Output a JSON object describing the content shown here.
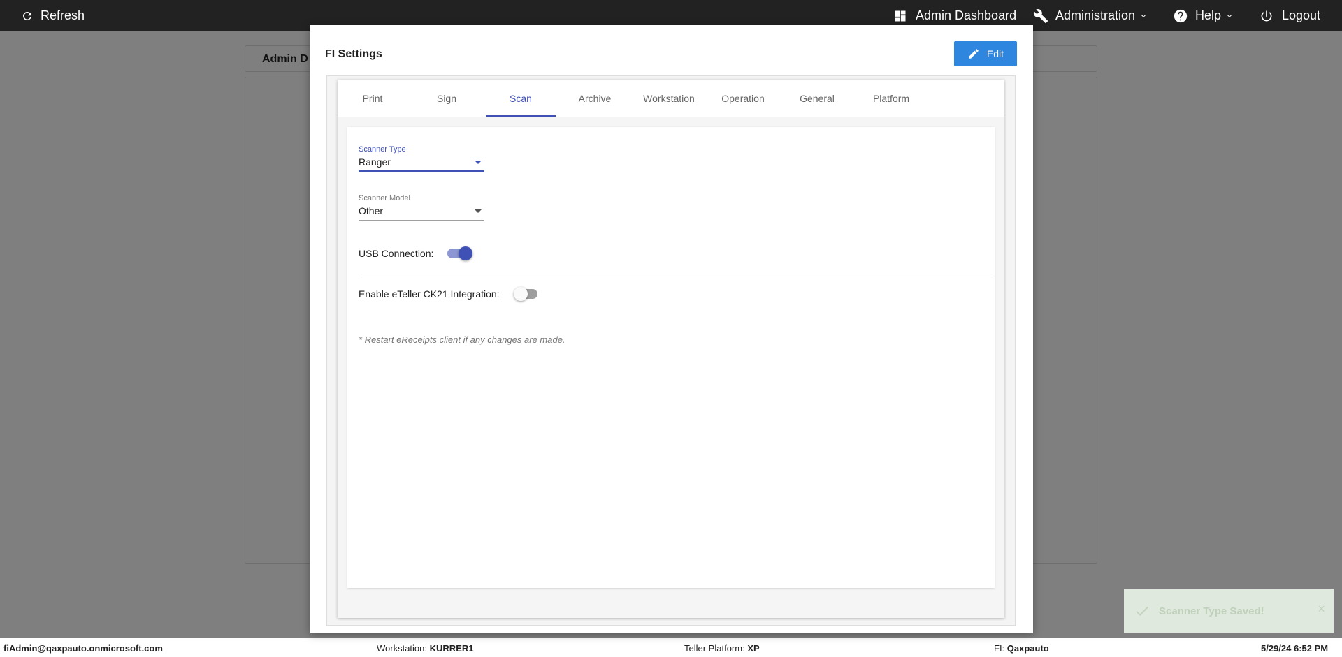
{
  "topbar": {
    "refresh": "Refresh",
    "admin_dashboard": "Admin Dashboard",
    "administration": "Administration",
    "help": "Help",
    "logout": "Logout"
  },
  "background": {
    "card_title": "Admin D"
  },
  "modal": {
    "title": "FI Settings",
    "edit_label": "Edit",
    "tabs": [
      {
        "label": "Print"
      },
      {
        "label": "Sign"
      },
      {
        "label": "Scan"
      },
      {
        "label": "Archive"
      },
      {
        "label": "Workstation"
      },
      {
        "label": "Operation"
      },
      {
        "label": "General"
      },
      {
        "label": "Platform"
      }
    ],
    "active_tab": "Scan",
    "scan": {
      "scanner_type_label": "Scanner Type",
      "scanner_type_value": "Ranger",
      "scanner_model_label": "Scanner Model",
      "scanner_model_value": "Other",
      "usb_connection_label": "USB Connection:",
      "usb_connection_on": true,
      "eteller_label": "Enable eTeller CK21 Integration:",
      "eteller_on": false,
      "note": "* Restart eReceipts client if any changes are made."
    }
  },
  "toast": {
    "message": "Scanner Type Saved!",
    "close": "×"
  },
  "footer": {
    "user": "fiAdmin@qaxpauto.onmicrosoft.com",
    "workstation_label": "Workstation:",
    "workstation_value": "KURRER1",
    "teller_platform_label": "Teller Platform:",
    "teller_platform_value": "XP",
    "fi_label": "FI:",
    "fi_value": "Qaxpauto",
    "datetime": "5/29/24 6:52 PM"
  },
  "colors": {
    "accent": "#3f51b5",
    "edit_button": "#2e86de",
    "topbar": "#222222"
  }
}
